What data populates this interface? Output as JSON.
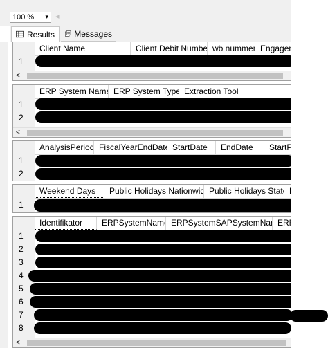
{
  "toolbar": {
    "zoom_value": "100 %",
    "zoom_caret": "▾",
    "separator": "◂"
  },
  "tabs": [
    {
      "label": "Results",
      "icon": "grid-icon",
      "active": true
    },
    {
      "label": "Messages",
      "icon": "messages-icon",
      "active": false
    }
  ],
  "panes": [
    {
      "headers": [
        "Client Name",
        "Client Debit Number",
        "wb nummer",
        "Engageme"
      ],
      "rows": [
        "1"
      ]
    },
    {
      "headers": [
        "ERP System Name",
        "ERP System Type",
        "Extraction Tool"
      ],
      "rows": [
        "1",
        "2"
      ]
    },
    {
      "headers": [
        "AnalysisPeriod",
        "FiscalYearEndDate",
        "StartDate",
        "EndDate",
        "StartPe"
      ],
      "rows": [
        "1",
        "2"
      ]
    },
    {
      "headers": [
        "Weekend Days",
        "Public Holidays Nationwide",
        "Public Holidays State",
        "F"
      ],
      "rows": [
        "1"
      ]
    },
    {
      "headers": [
        "Identifikator",
        "ERPSystemName",
        "ERPSystemSAPSystemName",
        "ERF"
      ],
      "rows": [
        "1",
        "2",
        "3",
        "4",
        "5",
        "6",
        "7",
        "8"
      ]
    }
  ],
  "scroll_left_arrow": "<",
  "colors": {
    "chrome": "#f0f0f0",
    "border": "#a0a0a0",
    "redaction": "#000000"
  }
}
